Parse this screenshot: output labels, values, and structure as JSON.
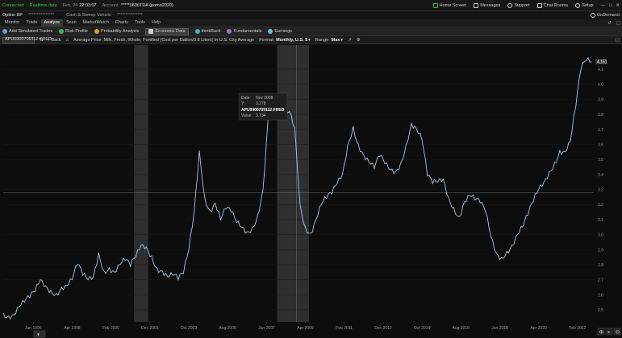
{
  "status": {
    "connected": "Connected",
    "data_mode": "Realtime data",
    "date": "Feb, 24",
    "time": "22:03:07",
    "account_label": "Account:",
    "account_value": "*****0636TDA (pomo2020)",
    "home_screen": "Home Screen",
    "messages": "Messages",
    "support": "Support",
    "chat_rooms": "Chat Rooms",
    "setup": "Setup"
  },
  "account_bar": {
    "option_bp_label": "Option BP",
    "option_bp_value": "***************",
    "cash_label": "Cash & Sweep Vehicle",
    "cash_value": "***************",
    "ondemand": "OnDemand"
  },
  "main_tabs": [
    "Monitor",
    "Trade",
    "Analyze",
    "Scan",
    "MarketWatch",
    "Charts",
    "Tools",
    "Help"
  ],
  "active_main_tab": "Analyze",
  "sub_tabs": [
    {
      "label": "Add Simulated Trades",
      "color": "#6aa0d8"
    },
    {
      "label": "Risk Profile",
      "color": "#3fb950"
    },
    {
      "label": "Probability Analysis",
      "color": "#d8a23a"
    },
    {
      "label": "Economic Data",
      "color": "#cfcfcf"
    },
    {
      "label": "thinkBack",
      "color": "#4ab0c0"
    },
    {
      "label": "Fundamentals",
      "color": "#a070d0"
    },
    {
      "label": "Earnings",
      "color": "#6ac0e8"
    }
  ],
  "active_sub_tab": "Economic Data",
  "toolbar": {
    "symbol": "APU0000709112:FRED",
    "back": "Back",
    "series_title": "Average Price: Milk, Fresh, Whole, Fortified (Cost per Gallon/3.8 Liters) in U.S. City Average",
    "format_label": "Format:",
    "format_value": "Monthly, U.S. $",
    "range_label": "Range:",
    "range_value": "Max"
  },
  "tooltip": {
    "date_label": "Date:",
    "date_value": "Nov 2008",
    "y_label": "Y:",
    "y_value": "3.278",
    "series": "APU0000709112:FRED",
    "value_label": "Value:",
    "value": "3.734"
  },
  "colors": {
    "line": "#a9c7df",
    "recession": "#2f2f2f",
    "grid": "#1a1a1a",
    "crosshair": "#8a8a8a"
  },
  "chart_data": {
    "type": "line",
    "x_start": 1995.0,
    "x_end": 2022.85,
    "ylim": [
      2.42,
      4.25
    ],
    "yticks": [
      2.5,
      2.6,
      2.7,
      2.8,
      2.9,
      3.0,
      3.1,
      3.2,
      3.3,
      3.4,
      3.5,
      3.6,
      3.7,
      3.8,
      3.9,
      4.0,
      4.1
    ],
    "xtick_labels": [
      "Jun 1996",
      "Apr 1998",
      "Feb 2000",
      "Dec 2001",
      "Oct 2003",
      "Aug 2005",
      "Jun 2007",
      "Apr 2009",
      "Feb 2011",
      "Dec 2012",
      "Oct 2014",
      "Aug 2016",
      "Jun 2018",
      "Apr 2020",
      "Feb 2022"
    ],
    "xtick_values": [
      1996.42,
      1998.25,
      2000.08,
      2001.92,
      2003.75,
      2005.58,
      2007.42,
      2009.25,
      2011.08,
      2012.92,
      2014.75,
      2016.58,
      2018.42,
      2020.25,
      2022.08
    ],
    "recessions": [
      [
        2001.17,
        2001.83
      ],
      [
        2007.92,
        2009.42
      ]
    ],
    "crosshair_x": 2008.83,
    "crosshair_y": 3.278,
    "last_value": 4.151,
    "points": [
      [
        1995.0,
        2.48
      ],
      [
        1995.25,
        2.46
      ],
      [
        1995.5,
        2.47
      ],
      [
        1995.75,
        2.52
      ],
      [
        1996.0,
        2.55
      ],
      [
        1996.25,
        2.58
      ],
      [
        1996.5,
        2.62
      ],
      [
        1996.75,
        2.7
      ],
      [
        1997.0,
        2.66
      ],
      [
        1997.25,
        2.63
      ],
      [
        1997.5,
        2.61
      ],
      [
        1997.75,
        2.65
      ],
      [
        1998.0,
        2.66
      ],
      [
        1998.25,
        2.7
      ],
      [
        1998.5,
        2.8
      ],
      [
        1998.75,
        2.73
      ],
      [
        1999.0,
        2.7
      ],
      [
        1999.25,
        2.72
      ],
      [
        1999.5,
        2.88
      ],
      [
        1999.75,
        2.76
      ],
      [
        2000.0,
        2.78
      ],
      [
        2000.25,
        2.75
      ],
      [
        2000.5,
        2.8
      ],
      [
        2000.75,
        2.83
      ],
      [
        2001.0,
        2.79
      ],
      [
        2001.25,
        2.85
      ],
      [
        2001.5,
        2.93
      ],
      [
        2001.75,
        2.92
      ],
      [
        2002.0,
        2.86
      ],
      [
        2002.25,
        2.78
      ],
      [
        2002.5,
        2.76
      ],
      [
        2002.75,
        2.72
      ],
      [
        2003.0,
        2.73
      ],
      [
        2003.25,
        2.7
      ],
      [
        2003.5,
        2.74
      ],
      [
        2003.75,
        2.9
      ],
      [
        2004.0,
        3.15
      ],
      [
        2004.25,
        3.56
      ],
      [
        2004.5,
        3.25
      ],
      [
        2004.75,
        3.16
      ],
      [
        2005.0,
        3.21
      ],
      [
        2005.25,
        3.1
      ],
      [
        2005.5,
        3.17
      ],
      [
        2005.75,
        3.15
      ],
      [
        2006.0,
        3.08
      ],
      [
        2006.25,
        3.05
      ],
      [
        2006.5,
        3.02
      ],
      [
        2006.75,
        3.05
      ],
      [
        2007.0,
        3.13
      ],
      [
        2007.25,
        3.3
      ],
      [
        2007.5,
        3.78
      ],
      [
        2007.75,
        3.84
      ],
      [
        2008.0,
        3.88
      ],
      [
        2008.25,
        3.79
      ],
      [
        2008.5,
        3.82
      ],
      [
        2008.75,
        3.71
      ],
      [
        2009.0,
        3.2
      ],
      [
        2009.25,
        3.05
      ],
      [
        2009.5,
        3.01
      ],
      [
        2009.75,
        3.1
      ],
      [
        2010.0,
        3.2
      ],
      [
        2010.25,
        3.24
      ],
      [
        2010.5,
        3.27
      ],
      [
        2010.75,
        3.34
      ],
      [
        2011.0,
        3.4
      ],
      [
        2011.25,
        3.6
      ],
      [
        2011.5,
        3.72
      ],
      [
        2011.75,
        3.6
      ],
      [
        2012.0,
        3.53
      ],
      [
        2012.25,
        3.48
      ],
      [
        2012.5,
        3.44
      ],
      [
        2012.75,
        3.52
      ],
      [
        2013.0,
        3.47
      ],
      [
        2013.25,
        3.43
      ],
      [
        2013.5,
        3.42
      ],
      [
        2013.75,
        3.48
      ],
      [
        2014.0,
        3.6
      ],
      [
        2014.25,
        3.74
      ],
      [
        2014.5,
        3.7
      ],
      [
        2014.75,
        3.63
      ],
      [
        2015.0,
        3.39
      ],
      [
        2015.25,
        3.34
      ],
      [
        2015.5,
        3.35
      ],
      [
        2015.75,
        3.37
      ],
      [
        2016.0,
        3.25
      ],
      [
        2016.25,
        3.18
      ],
      [
        2016.5,
        3.12
      ],
      [
        2016.75,
        3.22
      ],
      [
        2017.0,
        3.26
      ],
      [
        2017.25,
        3.23
      ],
      [
        2017.5,
        3.21
      ],
      [
        2017.75,
        3.15
      ],
      [
        2018.0,
        2.99
      ],
      [
        2018.25,
        2.88
      ],
      [
        2018.5,
        2.85
      ],
      [
        2018.75,
        2.89
      ],
      [
        2019.0,
        2.93
      ],
      [
        2019.25,
        3.0
      ],
      [
        2019.5,
        3.05
      ],
      [
        2019.75,
        3.13
      ],
      [
        2020.0,
        3.22
      ],
      [
        2020.25,
        3.3
      ],
      [
        2020.5,
        3.35
      ],
      [
        2020.75,
        3.42
      ],
      [
        2021.0,
        3.48
      ],
      [
        2021.25,
        3.56
      ],
      [
        2021.5,
        3.55
      ],
      [
        2021.75,
        3.62
      ],
      [
        2022.0,
        3.85
      ],
      [
        2022.25,
        4.1
      ],
      [
        2022.5,
        4.16
      ],
      [
        2022.75,
        4.15
      ]
    ]
  }
}
